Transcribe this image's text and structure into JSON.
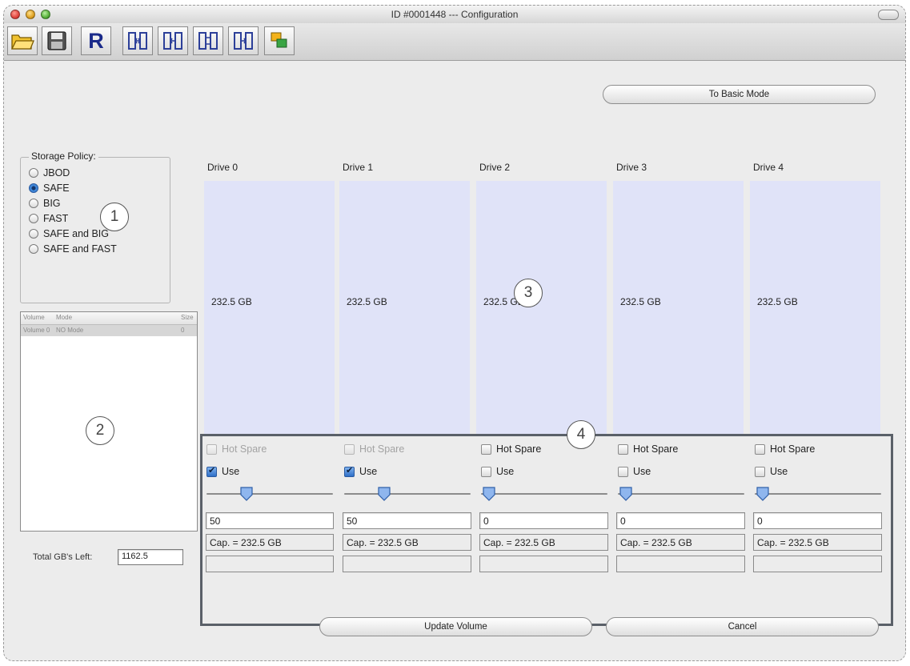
{
  "window": {
    "title": "ID #0001448 --- Configuration",
    "colors": {
      "close": "#e0443e",
      "minimize": "#dea123",
      "zoom": "#57b03a"
    }
  },
  "toolbar": {
    "buttons": [
      {
        "icon": "open-folder-icon"
      },
      {
        "icon": "save-disk-icon"
      },
      {
        "icon": "refresh-r-icon",
        "label": "R"
      },
      {
        "icon": "raid-mode-1-icon"
      },
      {
        "icon": "raid-mode-2-icon"
      },
      {
        "icon": "raid-mode-3-icon"
      },
      {
        "icon": "raid-mode-4-icon"
      },
      {
        "icon": "layers-icon"
      }
    ]
  },
  "basic_mode_button": "To Basic Mode",
  "storage_policy": {
    "legend": "Storage Policy:",
    "options": [
      {
        "label": "JBOD",
        "selected": false
      },
      {
        "label": "SAFE",
        "selected": true
      },
      {
        "label": "BIG",
        "selected": false
      },
      {
        "label": "FAST",
        "selected": false
      },
      {
        "label": "SAFE and BIG",
        "selected": false
      },
      {
        "label": "SAFE and FAST",
        "selected": false
      }
    ]
  },
  "volume_table": {
    "headers": [
      "Volume",
      "Mode",
      "Size"
    ],
    "rows": [
      [
        "Volume 0",
        "NO Mode",
        "0"
      ]
    ]
  },
  "total_left": {
    "label": "Total GB's Left:",
    "value": "1162.5"
  },
  "drives": [
    {
      "label": "Drive 0",
      "capacity": "232.5 GB",
      "hot_spare_label": "Hot Spare",
      "hot_spare_enabled": false,
      "use_label": "Use",
      "use_checked": true,
      "slider_value": 50,
      "value": "50",
      "cap_text": "Cap. = 232.5 GB"
    },
    {
      "label": "Drive 1",
      "capacity": "232.5 GB",
      "hot_spare_label": "Hot Spare",
      "hot_spare_enabled": false,
      "use_label": "Use",
      "use_checked": true,
      "slider_value": 50,
      "value": "50",
      "cap_text": "Cap. = 232.5 GB"
    },
    {
      "label": "Drive 2",
      "capacity": "232.5 GB",
      "hot_spare_label": "Hot Spare",
      "hot_spare_enabled": true,
      "use_label": "Use",
      "use_checked": false,
      "slider_value": 0,
      "value": "0",
      "cap_text": "Cap. = 232.5 GB"
    },
    {
      "label": "Drive 3",
      "capacity": "232.5 GB",
      "hot_spare_label": "Hot Spare",
      "hot_spare_enabled": true,
      "use_label": "Use",
      "use_checked": false,
      "slider_value": 0,
      "value": "0",
      "cap_text": "Cap. = 232.5 GB"
    },
    {
      "label": "Drive 4",
      "capacity": "232.5 GB",
      "hot_spare_label": "Hot Spare",
      "hot_spare_enabled": true,
      "use_label": "Use",
      "use_checked": false,
      "slider_value": 0,
      "value": "0",
      "cap_text": "Cap. = 232.5 GB"
    }
  ],
  "callouts": [
    "1",
    "2",
    "3",
    "4"
  ],
  "buttons": {
    "update": "Update Volume",
    "cancel": "Cancel"
  }
}
